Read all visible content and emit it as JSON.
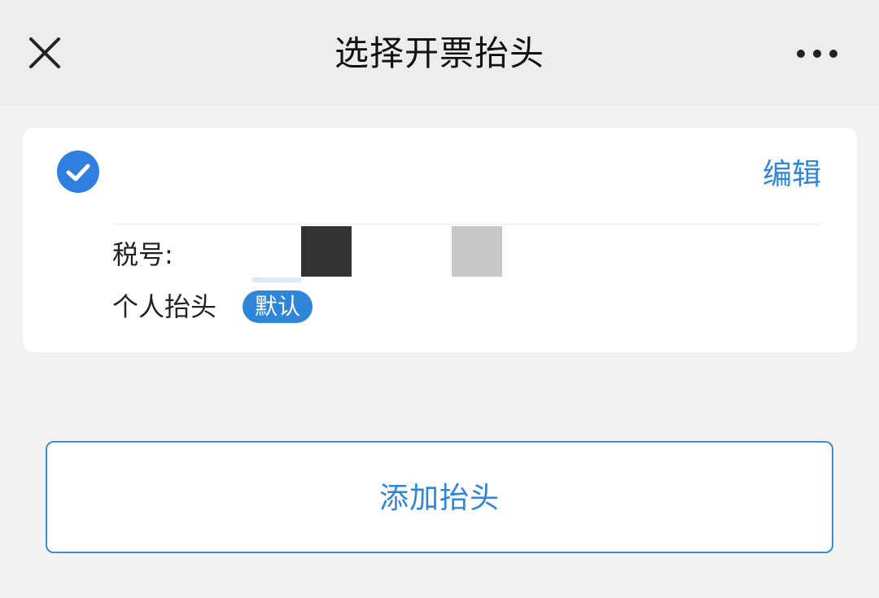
{
  "header": {
    "title": "选择开票抬头",
    "close_icon": "close-icon",
    "more_icon": "more-icon"
  },
  "card": {
    "selected": true,
    "check_icon": "check-circle-icon",
    "edit_label": "编辑",
    "tax_label": "税号:",
    "title_name": "个人抬头",
    "default_badge": "默认"
  },
  "add_button": {
    "label": "添加抬头"
  },
  "colors": {
    "accent": "#2f86d9",
    "check": "#2f7fe0",
    "background": "#f2f2f2",
    "nav_background": "#ededed"
  }
}
